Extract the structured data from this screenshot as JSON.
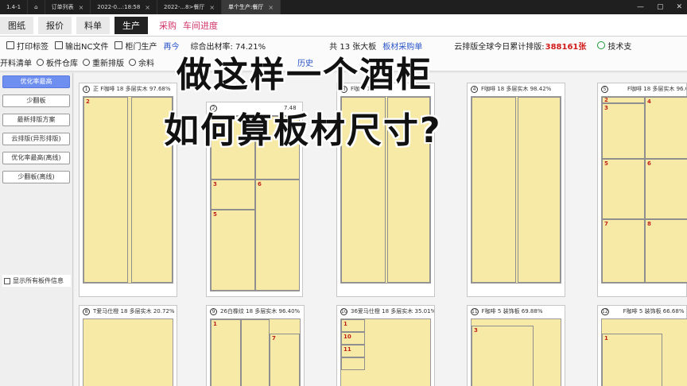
{
  "tabs": [
    {
      "label": "1.4-1",
      "active": false
    },
    {
      "label": "⌂",
      "active": false
    },
    {
      "label": "订单列表",
      "active": false
    },
    {
      "label": "2022-0...:18:58",
      "active": false
    },
    {
      "label": "2022-...8>餐厅",
      "active": false
    },
    {
      "label": "单个生产:餐厅",
      "active": true
    }
  ],
  "window_buttons": [
    "—",
    "▢",
    "✕"
  ],
  "menu": {
    "items": [
      {
        "label": "图纸",
        "active": false
      },
      {
        "label": "报价",
        "active": false
      },
      {
        "label": "料单",
        "active": false
      },
      {
        "label": "生产",
        "active": true
      }
    ],
    "links": [
      "采购",
      "车间进度"
    ]
  },
  "toolbar": {
    "print_label": "打印标签",
    "nc_label": "输出NC文件",
    "cabinet_label": "柜门生产",
    "partial_text": "再今",
    "yield_text": "综合出材率: 74.21%",
    "total_text": "共 13 张大板",
    "material_link": "板材采购单",
    "cloud_text": "云排版全球今日累计排版:",
    "cloud_count": "388161张",
    "support_label": "技术支"
  },
  "toolbar2": {
    "cut_list": "开料清单",
    "warehouse": "板件仓库",
    "relayout": "重新排版",
    "remainder": "余料",
    "history": "历史"
  },
  "sidebar": {
    "buttons": [
      {
        "label": "优化率最高",
        "active": true
      },
      {
        "label": "少翻板",
        "active": false
      },
      {
        "label": "最新排版方案",
        "active": false
      },
      {
        "label": "云排版(异形排版)",
        "active": false
      },
      {
        "label": "优化率最高(离线)",
        "active": false
      },
      {
        "label": "少翻板(离线)",
        "active": false
      }
    ],
    "show_all_label": "显示所有板件信息"
  },
  "sheets": [
    {
      "num": "1",
      "title": "正  F咖啡 18 多层实木 97.68%",
      "parts": [
        "2"
      ]
    },
    {
      "num": "2",
      "title": "7.48",
      "parts": [
        "3",
        "5",
        "6"
      ]
    },
    {
      "num": "3",
      "title": "F咖啡 18",
      "parts": []
    },
    {
      "num": "4",
      "title": "F咖啡 18 多层实木 98.42%",
      "parts": []
    },
    {
      "num": "5",
      "title": "F咖啡 18 多层实木 96.0",
      "parts": [
        "2",
        "3",
        "4",
        "5",
        "6",
        "7",
        "8"
      ]
    },
    {
      "num": "8",
      "title": "T爱马仕橙 18 多层实木 20.72%",
      "parts": []
    },
    {
      "num": "9",
      "title": "26白橡纹 18 多层实木 96.40%",
      "parts": [
        "1",
        "7"
      ]
    },
    {
      "num": "10",
      "title": "36爱马仕橙 18 多层实木 35.01%",
      "parts": [
        "1",
        "10",
        "11"
      ]
    },
    {
      "num": "11",
      "title": "F咖啡 5 装饰板 69.88%",
      "parts": [
        "3"
      ]
    },
    {
      "num": "12",
      "title": "F咖啡 5 装饰板 66.68%",
      "parts": [
        "1"
      ]
    }
  ],
  "overlay": {
    "line1": "做这样一个酒柜",
    "line2": "如何算板材尺寸?"
  }
}
